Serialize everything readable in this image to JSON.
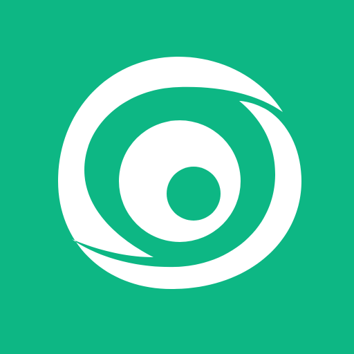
{
  "app_icon": {
    "name": "swirl-eye-logo",
    "background_color": "#0db784",
    "foreground_color": "#ffffff",
    "accent_color": "#0db784"
  }
}
